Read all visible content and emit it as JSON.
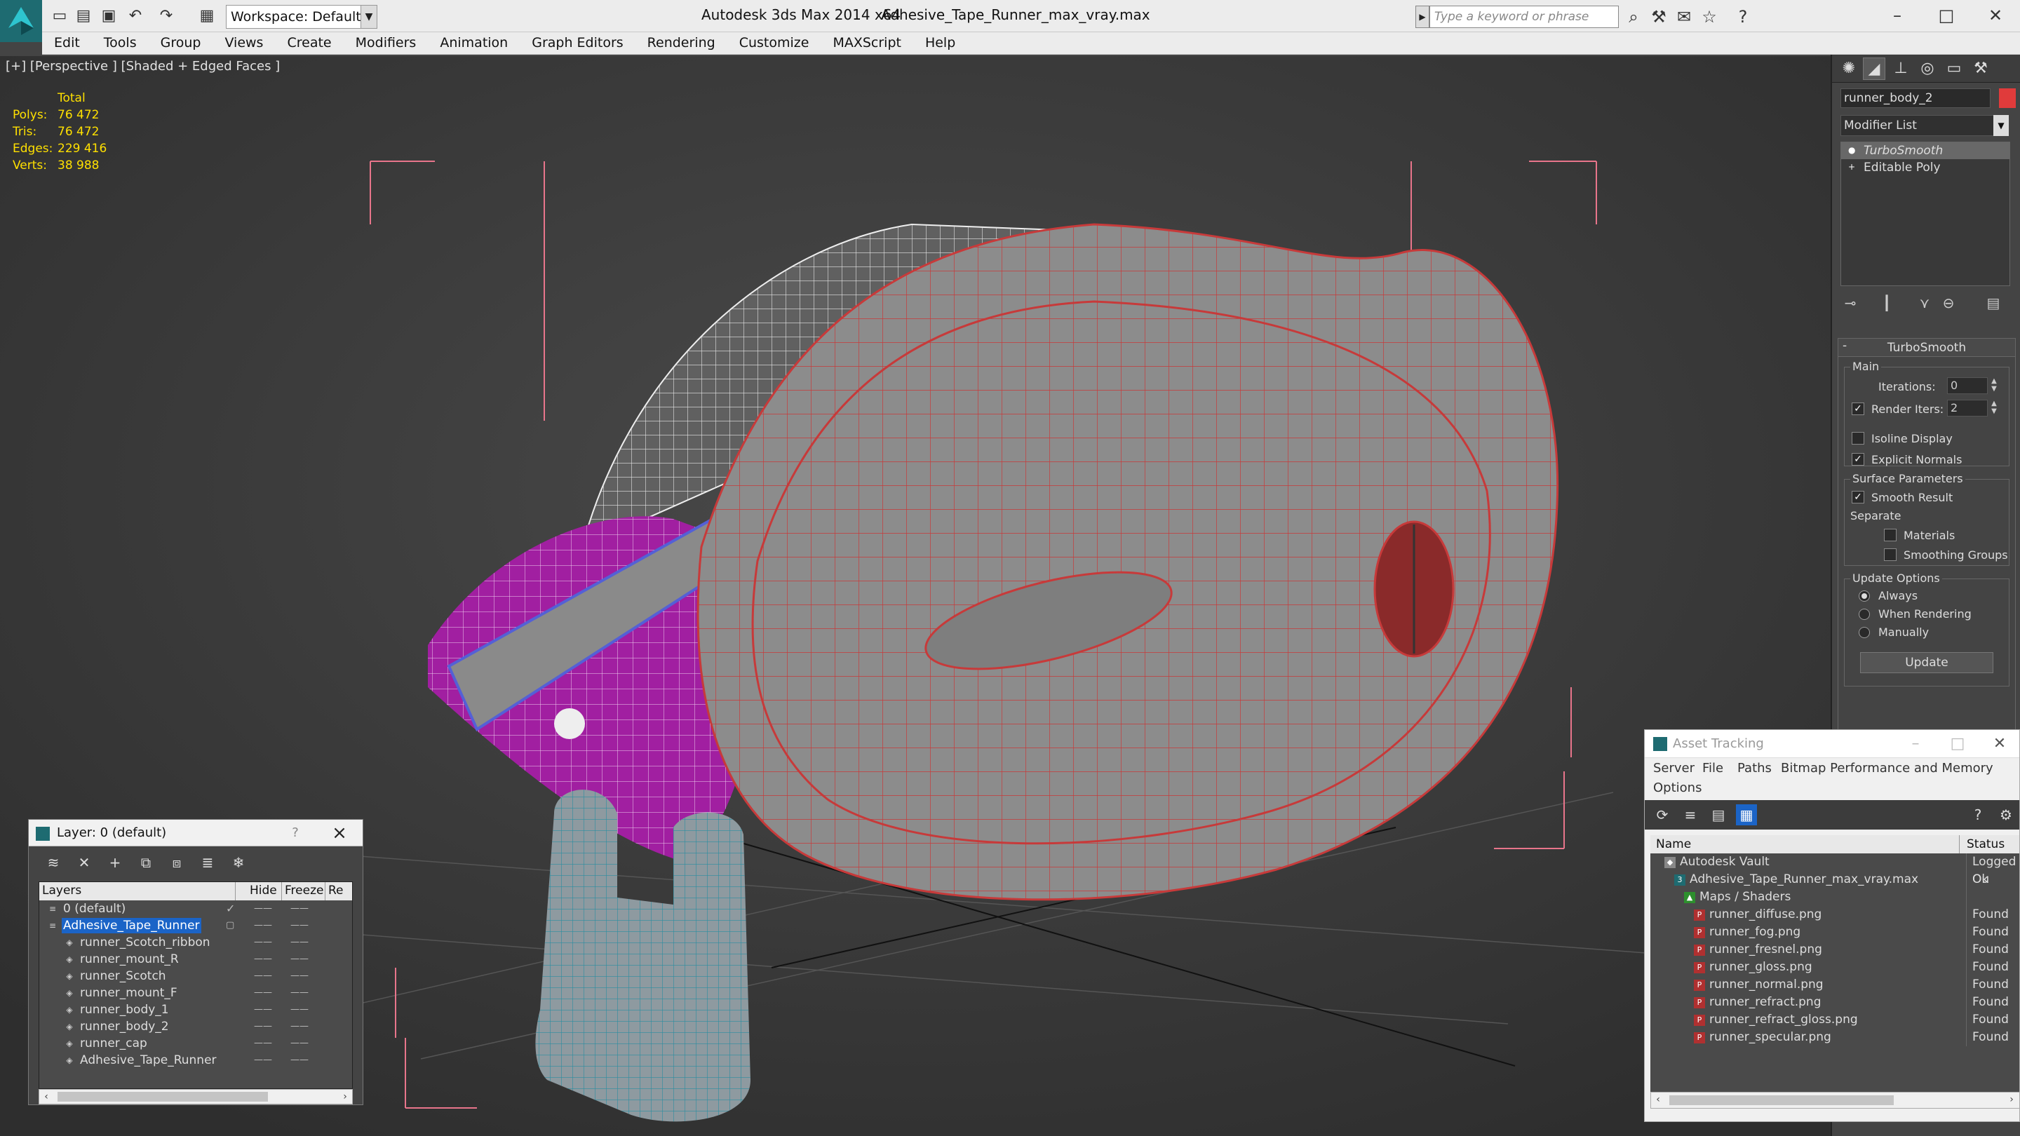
{
  "window": {
    "title_app": "Autodesk 3ds Max  2014 x64",
    "title_file": "Adhesive_Tape_Runner_max_vray.max",
    "workspace": "Workspace: Default",
    "search_placeholder": "Type a keyword or phrase"
  },
  "menu": [
    "Edit",
    "Tools",
    "Group",
    "Views",
    "Create",
    "Modifiers",
    "Animation",
    "Graph Editors",
    "Rendering",
    "Customize",
    "MAXScript",
    "Help"
  ],
  "viewport": {
    "label": "[+] [Perspective ] [Shaded + Edged Faces ]",
    "stats": {
      "header": "Total",
      "polys_label": "Polys:",
      "polys": "76 472",
      "tris_label": "Tris:",
      "tris": "76 472",
      "edges_label": "Edges:",
      "edges": "229 416",
      "verts_label": "Verts:",
      "verts": "38 988"
    }
  },
  "command_panel": {
    "object_name": "runner_body_2",
    "object_color": "#e03b3b",
    "modifier_list": "Modifier List",
    "stack": [
      "TurboSmooth",
      "Editable Poly"
    ],
    "rollout": {
      "title": "TurboSmooth",
      "main": "Main",
      "iterations_label": "Iterations:",
      "iterations": "0",
      "render_iters_label": "Render Iters:",
      "render_iters": "2",
      "isoline": "Isoline Display",
      "explicit_normals": "Explicit Normals",
      "surface": "Surface Parameters",
      "smooth_result": "Smooth Result",
      "separate": "Separate",
      "materials": "Materials",
      "smoothing_groups": "Smoothing Groups",
      "update_options": "Update Options",
      "always": "Always",
      "when_rendering": "When Rendering",
      "manually": "Manually",
      "update_btn": "Update"
    }
  },
  "layer_window": {
    "title": "Layer: 0 (default)",
    "help": "?",
    "columns": [
      "Layers",
      "Hide",
      "Freeze",
      "Re"
    ],
    "rows": [
      {
        "name": "0 (default)",
        "indent": 1,
        "check": "✓"
      },
      {
        "name": "Adhesive_Tape_Runner",
        "indent": 1,
        "selected": true
      },
      {
        "name": "runner_Scotch_ribbon",
        "indent": 2
      },
      {
        "name": "runner_mount_R",
        "indent": 2
      },
      {
        "name": "runner_Scotch",
        "indent": 2
      },
      {
        "name": "runner_mount_F",
        "indent": 2
      },
      {
        "name": "runner_body_1",
        "indent": 2
      },
      {
        "name": "runner_body_2",
        "indent": 2
      },
      {
        "name": "runner_cap",
        "indent": 2
      },
      {
        "name": "Adhesive_Tape_Runner",
        "indent": 2
      }
    ]
  },
  "asset_tracking": {
    "title": "Asset Tracking",
    "menu": [
      "Server",
      "File",
      "Paths",
      "Bitmap Performance and Memory",
      "Options"
    ],
    "columns": [
      "Name",
      "Status"
    ],
    "rows": [
      {
        "name": "Autodesk Vault",
        "status": "Logged Ou",
        "indent": 0,
        "icon": "vault"
      },
      {
        "name": "Adhesive_Tape_Runner_max_vray.max",
        "status": "Ok",
        "indent": 1,
        "icon": "max"
      },
      {
        "name": "Maps / Shaders",
        "status": "",
        "indent": 2,
        "icon": "folder"
      },
      {
        "name": "runner_diffuse.png",
        "status": "Found",
        "indent": 3,
        "icon": "png"
      },
      {
        "name": "runner_fog.png",
        "status": "Found",
        "indent": 3,
        "icon": "png"
      },
      {
        "name": "runner_fresnel.png",
        "status": "Found",
        "indent": 3,
        "icon": "png"
      },
      {
        "name": "runner_gloss.png",
        "status": "Found",
        "indent": 3,
        "icon": "png"
      },
      {
        "name": "runner_normal.png",
        "status": "Found",
        "indent": 3,
        "icon": "png"
      },
      {
        "name": "runner_refract.png",
        "status": "Found",
        "indent": 3,
        "icon": "png"
      },
      {
        "name": "runner_refract_gloss.png",
        "status": "Found",
        "indent": 3,
        "icon": "png"
      },
      {
        "name": "runner_specular.png",
        "status": "Found",
        "indent": 3,
        "icon": "png"
      }
    ]
  }
}
